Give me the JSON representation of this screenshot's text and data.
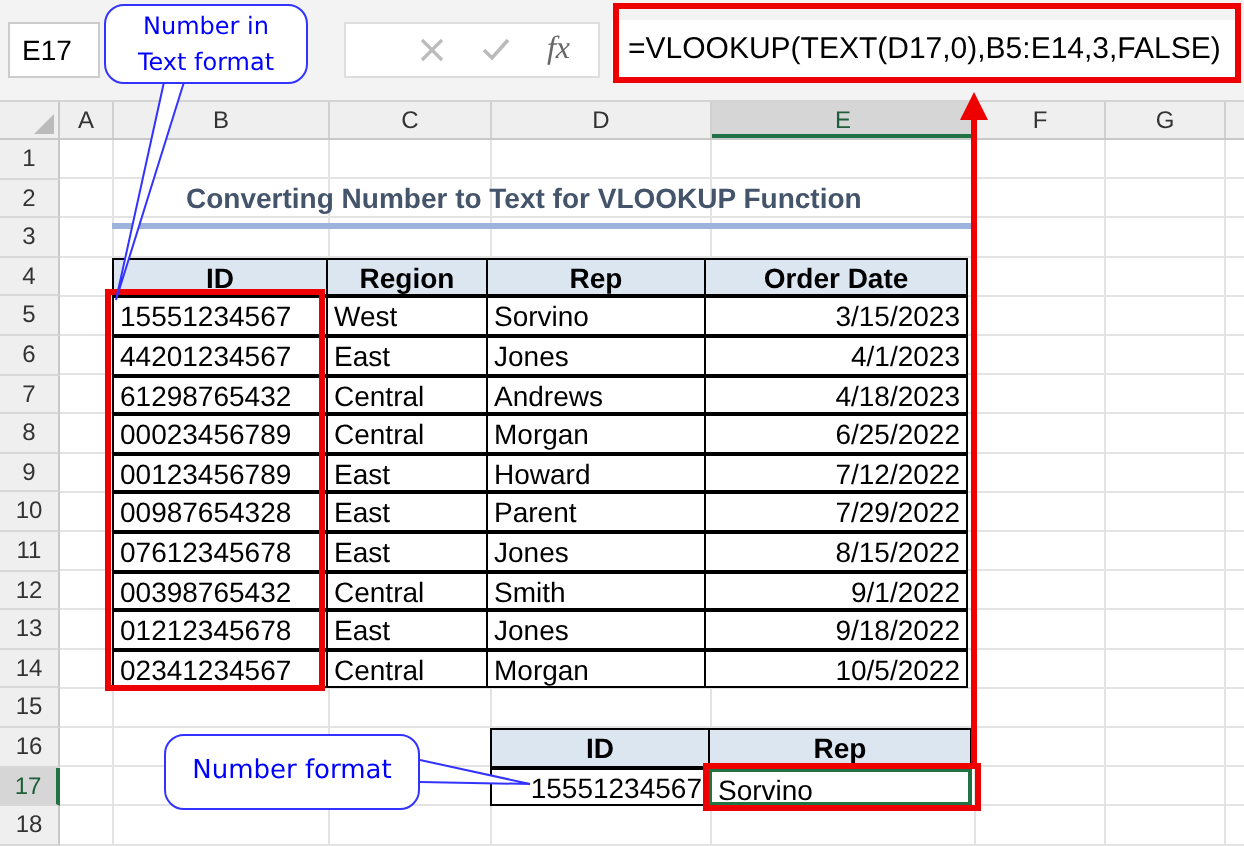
{
  "formula_bar": {
    "name_box": "E17",
    "function_label": "fx",
    "formula": "=VLOOKUP(TEXT(D17,0),B5:E14,3,FALSE)"
  },
  "column_headers": [
    {
      "label": "A",
      "selected": false
    },
    {
      "label": "B",
      "selected": false
    },
    {
      "label": "C",
      "selected": false
    },
    {
      "label": "D",
      "selected": false
    },
    {
      "label": "E",
      "selected": true
    },
    {
      "label": "F",
      "selected": false
    },
    {
      "label": "G",
      "selected": false
    }
  ],
  "row_headers": [
    {
      "label": "1",
      "selected": false
    },
    {
      "label": "2",
      "selected": false
    },
    {
      "label": "3",
      "selected": false
    },
    {
      "label": "4",
      "selected": false
    },
    {
      "label": "5",
      "selected": false
    },
    {
      "label": "6",
      "selected": false
    },
    {
      "label": "7",
      "selected": false
    },
    {
      "label": "8",
      "selected": false
    },
    {
      "label": "9",
      "selected": false
    },
    {
      "label": "10",
      "selected": false
    },
    {
      "label": "11",
      "selected": false
    },
    {
      "label": "12",
      "selected": false
    },
    {
      "label": "13",
      "selected": false
    },
    {
      "label": "14",
      "selected": false
    },
    {
      "label": "15",
      "selected": false
    },
    {
      "label": "16",
      "selected": false
    },
    {
      "label": "17",
      "selected": true
    },
    {
      "label": "18",
      "selected": false
    }
  ],
  "title": "Converting Number to Text for VLOOKUP Function",
  "table": {
    "columns": [
      "ID",
      "Region",
      "Rep",
      "Order Date"
    ],
    "rows": [
      [
        "15551234567",
        "West",
        "Sorvino",
        "3/15/2023"
      ],
      [
        "44201234567",
        "East",
        "Jones",
        "4/1/2023"
      ],
      [
        "61298765432",
        "Central",
        "Andrews",
        "4/18/2023"
      ],
      [
        "00023456789",
        "Central",
        "Morgan",
        "6/25/2022"
      ],
      [
        "00123456789",
        "East",
        "Howard",
        "7/12/2022"
      ],
      [
        "00987654328",
        "East",
        "Parent",
        "7/29/2022"
      ],
      [
        "07612345678",
        "East",
        "Jones",
        "8/15/2022"
      ],
      [
        "00398765432",
        "Central",
        "Smith",
        "9/1/2022"
      ],
      [
        "01212345678",
        "East",
        "Jones",
        "9/18/2022"
      ],
      [
        "02341234567",
        "Central",
        "Morgan",
        "10/5/2022"
      ]
    ]
  },
  "lookup": {
    "columns": [
      "ID",
      "Rep"
    ],
    "values": [
      "15551234567",
      "Sorvino"
    ]
  },
  "callouts": [
    {
      "text": "Number in Text format"
    },
    {
      "text": "Number format"
    }
  ]
}
